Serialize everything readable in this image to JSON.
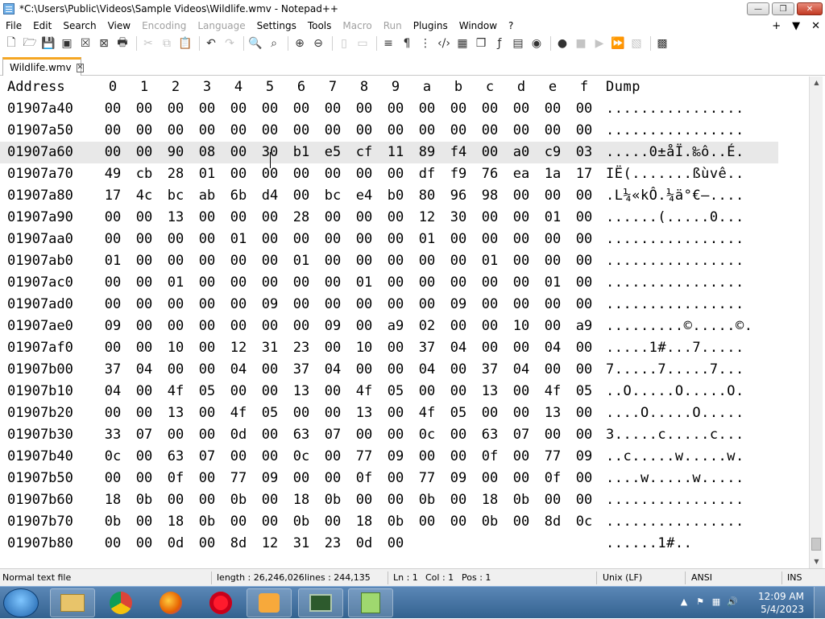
{
  "window": {
    "title": "*C:\\Users\\Public\\Videos\\Sample Videos\\Wildlife.wmv - Notepad++"
  },
  "menu": {
    "items": [
      {
        "label": "File",
        "disabled": false
      },
      {
        "label": "Edit",
        "disabled": false
      },
      {
        "label": "Search",
        "disabled": false
      },
      {
        "label": "View",
        "disabled": false
      },
      {
        "label": "Encoding",
        "disabled": true
      },
      {
        "label": "Language",
        "disabled": true
      },
      {
        "label": "Settings",
        "disabled": false
      },
      {
        "label": "Tools",
        "disabled": false
      },
      {
        "label": "Macro",
        "disabled": true
      },
      {
        "label": "Run",
        "disabled": true
      },
      {
        "label": "Plugins",
        "disabled": false
      },
      {
        "label": "Window",
        "disabled": false
      },
      {
        "label": "?",
        "disabled": false
      }
    ],
    "right": [
      "+",
      "▼",
      "✕"
    ]
  },
  "tab": {
    "label": "Wildlife.wmv"
  },
  "hex": {
    "header": {
      "address": "Address",
      "cols": [
        "0",
        "1",
        "2",
        "3",
        "4",
        "5",
        "6",
        "7",
        "8",
        "9",
        "a",
        "b",
        "c",
        "d",
        "e",
        "f"
      ],
      "dump": "Dump"
    },
    "rows": [
      {
        "addr": "01907a40",
        "bytes": [
          "00",
          "00",
          "00",
          "00",
          "00",
          "00",
          "00",
          "00",
          "00",
          "00",
          "00",
          "00",
          "00",
          "00",
          "00",
          "00"
        ],
        "dump": "................"
      },
      {
        "addr": "01907a50",
        "bytes": [
          "00",
          "00",
          "00",
          "00",
          "00",
          "00",
          "00",
          "00",
          "00",
          "00",
          "00",
          "00",
          "00",
          "00",
          "00",
          "00"
        ],
        "dump": "................"
      },
      {
        "addr": "01907a60",
        "bytes": [
          "00",
          "00",
          "90",
          "08",
          "00",
          "30",
          "b1",
          "e5",
          "cf",
          "11",
          "89",
          "f4",
          "00",
          "a0",
          "c9",
          "03"
        ],
        "dump": ".....0±åÏ.‰ô..É."
      },
      {
        "addr": "01907a70",
        "bytes": [
          "49",
          "cb",
          "28",
          "01",
          "00",
          "00",
          "00",
          "00",
          "00",
          "00",
          "df",
          "f9",
          "76",
          "ea",
          "1a",
          "17"
        ],
        "dump": "IË(.......ßùvê.."
      },
      {
        "addr": "01907a80",
        "bytes": [
          "17",
          "4c",
          "bc",
          "ab",
          "6b",
          "d4",
          "00",
          "bc",
          "e4",
          "b0",
          "80",
          "96",
          "98",
          "00",
          "00",
          "00"
        ],
        "dump": ".L¼«kÔ.¼ä°€–...."
      },
      {
        "addr": "01907a90",
        "bytes": [
          "00",
          "00",
          "13",
          "00",
          "00",
          "00",
          "28",
          "00",
          "00",
          "00",
          "12",
          "30",
          "00",
          "00",
          "01",
          "00"
        ],
        "dump": "......(.....0..."
      },
      {
        "addr": "01907aa0",
        "bytes": [
          "00",
          "00",
          "00",
          "00",
          "01",
          "00",
          "00",
          "00",
          "00",
          "00",
          "01",
          "00",
          "00",
          "00",
          "00",
          "00"
        ],
        "dump": "................"
      },
      {
        "addr": "01907ab0",
        "bytes": [
          "01",
          "00",
          "00",
          "00",
          "00",
          "00",
          "01",
          "00",
          "00",
          "00",
          "00",
          "00",
          "01",
          "00",
          "00",
          "00"
        ],
        "dump": "................"
      },
      {
        "addr": "01907ac0",
        "bytes": [
          "00",
          "00",
          "01",
          "00",
          "00",
          "00",
          "00",
          "00",
          "01",
          "00",
          "00",
          "00",
          "00",
          "00",
          "01",
          "00"
        ],
        "dump": "................"
      },
      {
        "addr": "01907ad0",
        "bytes": [
          "00",
          "00",
          "00",
          "00",
          "00",
          "09",
          "00",
          "00",
          "00",
          "00",
          "00",
          "09",
          "00",
          "00",
          "00",
          "00"
        ],
        "dump": "................"
      },
      {
        "addr": "01907ae0",
        "bytes": [
          "09",
          "00",
          "00",
          "00",
          "00",
          "00",
          "00",
          "09",
          "00",
          "a9",
          "02",
          "00",
          "00",
          "10",
          "00",
          "a9"
        ],
        "dump": ".........©.....©."
      },
      {
        "addr": "01907af0",
        "bytes": [
          "00",
          "00",
          "10",
          "00",
          "12",
          "31",
          "23",
          "00",
          "10",
          "00",
          "37",
          "04",
          "00",
          "00",
          "04",
          "00"
        ],
        "dump": ".....1#...7....."
      },
      {
        "addr": "01907b00",
        "bytes": [
          "37",
          "04",
          "00",
          "00",
          "04",
          "00",
          "37",
          "04",
          "00",
          "00",
          "04",
          "00",
          "37",
          "04",
          "00",
          "00"
        ],
        "dump": "7.....7.....7..."
      },
      {
        "addr": "01907b10",
        "bytes": [
          "04",
          "00",
          "4f",
          "05",
          "00",
          "00",
          "13",
          "00",
          "4f",
          "05",
          "00",
          "00",
          "13",
          "00",
          "4f",
          "05"
        ],
        "dump": "..O.....O.....O."
      },
      {
        "addr": "01907b20",
        "bytes": [
          "00",
          "00",
          "13",
          "00",
          "4f",
          "05",
          "00",
          "00",
          "13",
          "00",
          "4f",
          "05",
          "00",
          "00",
          "13",
          "00"
        ],
        "dump": "....O.....O....."
      },
      {
        "addr": "01907b30",
        "bytes": [
          "33",
          "07",
          "00",
          "00",
          "0d",
          "00",
          "63",
          "07",
          "00",
          "00",
          "0c",
          "00",
          "63",
          "07",
          "00",
          "00"
        ],
        "dump": "3.....c.....c..."
      },
      {
        "addr": "01907b40",
        "bytes": [
          "0c",
          "00",
          "63",
          "07",
          "00",
          "00",
          "0c",
          "00",
          "77",
          "09",
          "00",
          "00",
          "0f",
          "00",
          "77",
          "09"
        ],
        "dump": "..c.....w.....w."
      },
      {
        "addr": "01907b50",
        "bytes": [
          "00",
          "00",
          "0f",
          "00",
          "77",
          "09",
          "00",
          "00",
          "0f",
          "00",
          "77",
          "09",
          "00",
          "00",
          "0f",
          "00"
        ],
        "dump": "....w.....w....."
      },
      {
        "addr": "01907b60",
        "bytes": [
          "18",
          "0b",
          "00",
          "00",
          "0b",
          "00",
          "18",
          "0b",
          "00",
          "00",
          "0b",
          "00",
          "18",
          "0b",
          "00",
          "00"
        ],
        "dump": "................"
      },
      {
        "addr": "01907b70",
        "bytes": [
          "0b",
          "00",
          "18",
          "0b",
          "00",
          "00",
          "0b",
          "00",
          "18",
          "0b",
          "00",
          "00",
          "0b",
          "00",
          "8d",
          "0c"
        ],
        "dump": "................"
      },
      {
        "addr": "01907b80",
        "bytes": [
          "00",
          "00",
          "0d",
          "00",
          "8d",
          "12",
          "31",
          "23",
          "0d",
          "00"
        ],
        "dump": "......1#.."
      }
    ],
    "highlighted_row": 2
  },
  "status": {
    "type": "Normal text file",
    "length": "length : 26,246,026",
    "lines": "lines : 244,135",
    "ln": "Ln : 1",
    "col": "Col : 1",
    "pos": "Pos : 1",
    "eol": "Unix (LF)",
    "encoding": "ANSI",
    "mode": "INS"
  },
  "taskbar": {
    "apps": [
      "windows-explorer",
      "chrome",
      "firefox",
      "opera",
      "media-player",
      "terminal",
      "notepad-plus-plus"
    ],
    "time": "12:09 AM",
    "date": "5/4/2023"
  }
}
